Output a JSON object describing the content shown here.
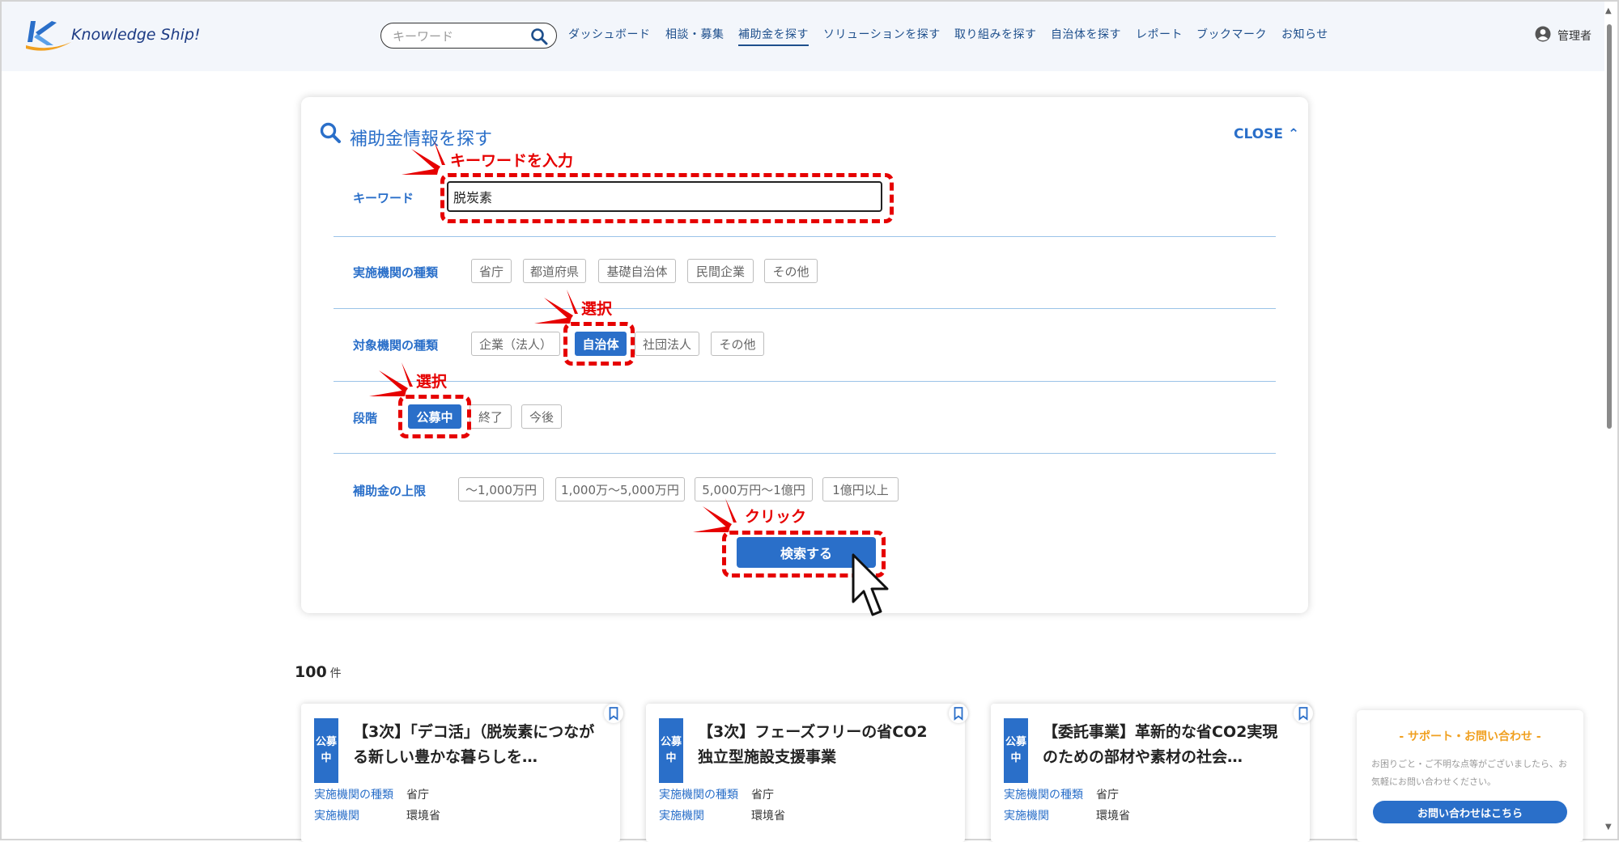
{
  "header": {
    "logo_text": "Knowledge Ship!",
    "search_placeholder": "キーワード",
    "nav": [
      {
        "label": "ダッシュボード"
      },
      {
        "label": "相談・募集"
      },
      {
        "label": "補助金を探す"
      },
      {
        "label": "ソリューションを探す"
      },
      {
        "label": "取り組みを探す"
      },
      {
        "label": "自治体を探す"
      },
      {
        "label": "レポート"
      },
      {
        "label": "ブックマーク"
      },
      {
        "label": "お知らせ"
      }
    ],
    "active_nav": "補助金を探す",
    "user_label": "管理者"
  },
  "panel": {
    "title": "補助金情報を探す",
    "close_label": "CLOSE ⌃",
    "keyword_label": "キーワード",
    "keyword_value": "脱炭素",
    "implementer_label": "実施機関の種類",
    "implementer_options": [
      "省庁",
      "都道府県",
      "基礎自治体",
      "民間企業",
      "その他"
    ],
    "target_label": "対象機関の種類",
    "target_options": [
      "企業（法人）",
      "自治体",
      "社団法人",
      "その他"
    ],
    "target_selected": "自治体",
    "stage_label": "段階",
    "stage_options": [
      "公募中",
      "終了",
      "今後"
    ],
    "stage_selected": "公募中",
    "limit_label": "補助金の上限",
    "limit_options": [
      "〜1,000万円",
      "1,000万〜5,000万円",
      "5,000万円〜1億円",
      "1億円以上"
    ],
    "submit_label": "検索する"
  },
  "annotations": {
    "keyword": "キーワードを入力",
    "select1": "選択",
    "select2": "選択",
    "click": "クリック"
  },
  "results": {
    "count": "100",
    "count_unit": "件",
    "cards": [
      {
        "badge": "公募中",
        "title": "【3次】「デコ活」（脱炭素につながる新しい豊かな暮らしを…",
        "implementer_label": "実施機関の種類",
        "implementer_value": "省庁",
        "org_label": "実施機関",
        "org_value": "環境省"
      },
      {
        "badge": "公募中",
        "title": "【3次】フェーズフリーの省CO2独立型施設支援事業",
        "implementer_label": "実施機関の種類",
        "implementer_value": "省庁",
        "org_label": "実施機関",
        "org_value": "環境省"
      },
      {
        "badge": "公募中",
        "title": "【委託事業】革新的な省CO2実現のための部材や素材の社会…",
        "implementer_label": "実施機関の種類",
        "implementer_value": "省庁",
        "org_label": "実施機関",
        "org_value": "環境省"
      }
    ]
  },
  "support": {
    "title": "- サポート・お問い合わせ -",
    "desc": "お困りごと・ご不明な点等がございましたら、お気軽にお問い合わせください。",
    "button": "お問い合わせはこちら"
  },
  "colors": {
    "accent": "#2a6fc9",
    "annotation": "#e60000",
    "support_title": "#f0a020"
  }
}
